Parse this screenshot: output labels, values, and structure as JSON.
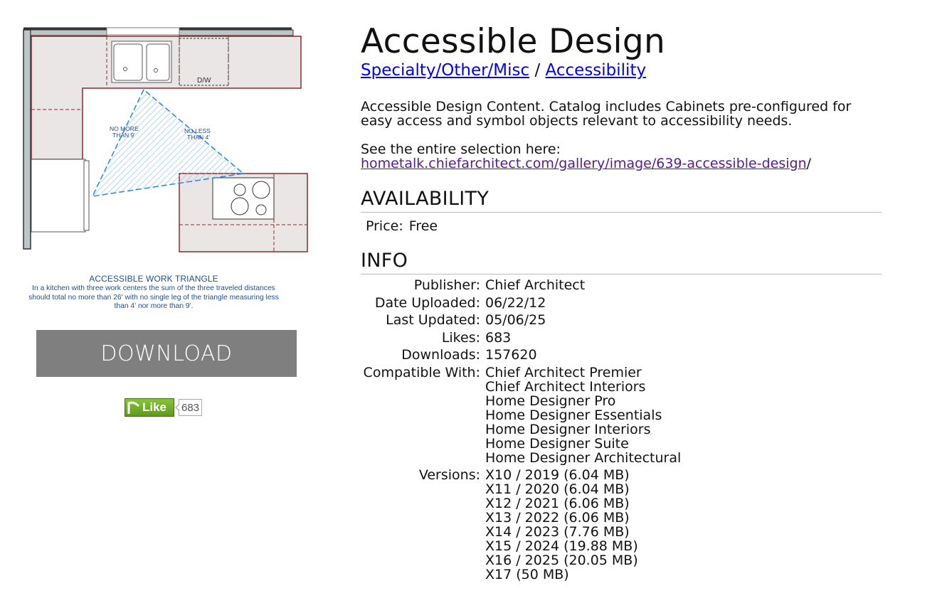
{
  "product": {
    "title": "Accessible Design",
    "breadcrumb": [
      {
        "label": "Specialty/Other/Misc"
      },
      {
        "label": "Accessibility"
      }
    ],
    "breadcrumb_sep": "/",
    "description": "Accessible Design Content. Catalog includes Cabinets pre-configured for easy access and symbol objects relevant to accessibility needs.",
    "see_prefix": "See the entire selection here: ",
    "see_link": "hometalk.chiefarchitect.com/gallery/image/639-accessible-design",
    "see_suffix": "/"
  },
  "image": {
    "dw_label": "D/W",
    "note_left_1": "NO MORE",
    "note_left_2": "THAN 9'",
    "note_right_1": "NO LESS",
    "note_right_2": "THAN 4'",
    "caption_title": "ACCESSIBLE WORK TRIANGLE",
    "caption_text": "In a kitchen with three work centers the sum of the three traveled distances should total no more than 26' with no single leg of the triangle measuring less than 4' nor more than 9'."
  },
  "download": {
    "label": "DOWNLOAD"
  },
  "like": {
    "label": "Like",
    "count": "683"
  },
  "availability": {
    "heading": "AVAILABILITY",
    "price_label": "Price:",
    "price_value": "Free"
  },
  "info": {
    "heading": "INFO",
    "publisher_label": "Publisher:",
    "publisher": "Chief Architect",
    "date_uploaded_label": "Date Uploaded:",
    "date_uploaded": "06/22/12",
    "last_updated_label": "Last Updated:",
    "last_updated": "05/06/25",
    "likes_label": "Likes:",
    "likes": "683",
    "downloads_label": "Downloads:",
    "downloads": "157620",
    "compatible_label": "Compatible With:",
    "compatible": [
      "Chief Architect Premier",
      "Chief Architect Interiors",
      "Home Designer Pro",
      "Home Designer Essentials",
      "Home Designer Interiors",
      "Home Designer Suite",
      "Home Designer Architectural"
    ],
    "versions_label": "Versions:",
    "versions": [
      "X10 / 2019 (6.04 MB)",
      "X11 / 2020 (6.04 MB)",
      "X12 / 2021 (6.06 MB)",
      "X13 / 2022 (6.06 MB)",
      "X14 / 2023 (7.76 MB)",
      "X15 / 2024 (19.88 MB)",
      "X16 / 2025 (20.05 MB)",
      "X17 (50 MB)"
    ]
  },
  "colors": {
    "download_bg": "#7f7f7f",
    "link": "#0000ee",
    "visited_link": "#551a8b",
    "cabinet_fill": "#ebe6e6",
    "cabinet_stroke": "#8b2a2a",
    "triangle": "#1e88e5",
    "caption": "#1f4e8c"
  }
}
